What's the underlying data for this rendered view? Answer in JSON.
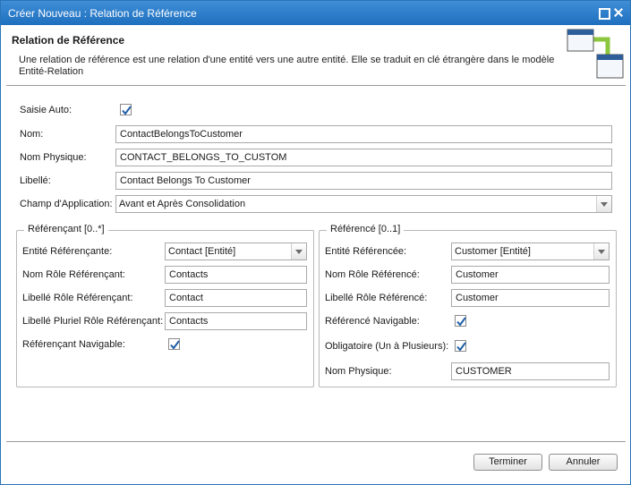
{
  "window": {
    "title": "Créer Nouveau : Relation de Référence"
  },
  "header": {
    "title": "Relation de Référence",
    "description": "Une relation de référence est une relation d'une entité vers une autre entité. Elle se traduit en clé étrangère dans le modèle Entité-Relation"
  },
  "form": {
    "saisie_auto_label": "Saisie Auto:",
    "saisie_auto_checked": true,
    "nom_label": "Nom:",
    "nom_value": "ContactBelongsToCustomer",
    "nom_physique_label": "Nom Physique:",
    "nom_physique_value": "CONTACT_BELONGS_TO_CUSTOM",
    "libelle_label": "Libellé:",
    "libelle_value": "Contact Belongs To Customer",
    "champ_label": "Champ d'Application:",
    "champ_value": "Avant et Après Consolidation"
  },
  "referencant": {
    "legend": "Référençant [0..*]",
    "entite_label": "Entité Référençante:",
    "entite_value": "Contact [Entité]",
    "nom_role_label": "Nom Rôle Référençant:",
    "nom_role_value": "Contacts",
    "libelle_role_label": "Libellé Rôle Référençant:",
    "libelle_role_value": "Contact",
    "libelle_pluriel_label": "Libellé Pluriel Rôle Référençant:",
    "libelle_pluriel_value": "Contacts",
    "navigable_label": "Référençant Navigable:",
    "navigable_checked": true
  },
  "reference": {
    "legend": "Référencé [0..1]",
    "entite_label": "Entité Référencée:",
    "entite_value": "Customer [Entité]",
    "nom_role_label": "Nom Rôle Référencé:",
    "nom_role_value": "Customer",
    "libelle_role_label": "Libellé Rôle Référencé:",
    "libelle_role_value": "Customer",
    "navigable_label": "Référencé Navigable:",
    "navigable_checked": true,
    "obligatoire_label": "Obligatoire (Un à Plusieurs):",
    "obligatoire_checked": true,
    "nom_physique_label": "Nom Physique:",
    "nom_physique_value": "CUSTOMER"
  },
  "buttons": {
    "finish": "Terminer",
    "cancel": "Annuler"
  },
  "colors": {
    "titlebar": "#1e6fbf",
    "check": "#1f5fa8"
  }
}
